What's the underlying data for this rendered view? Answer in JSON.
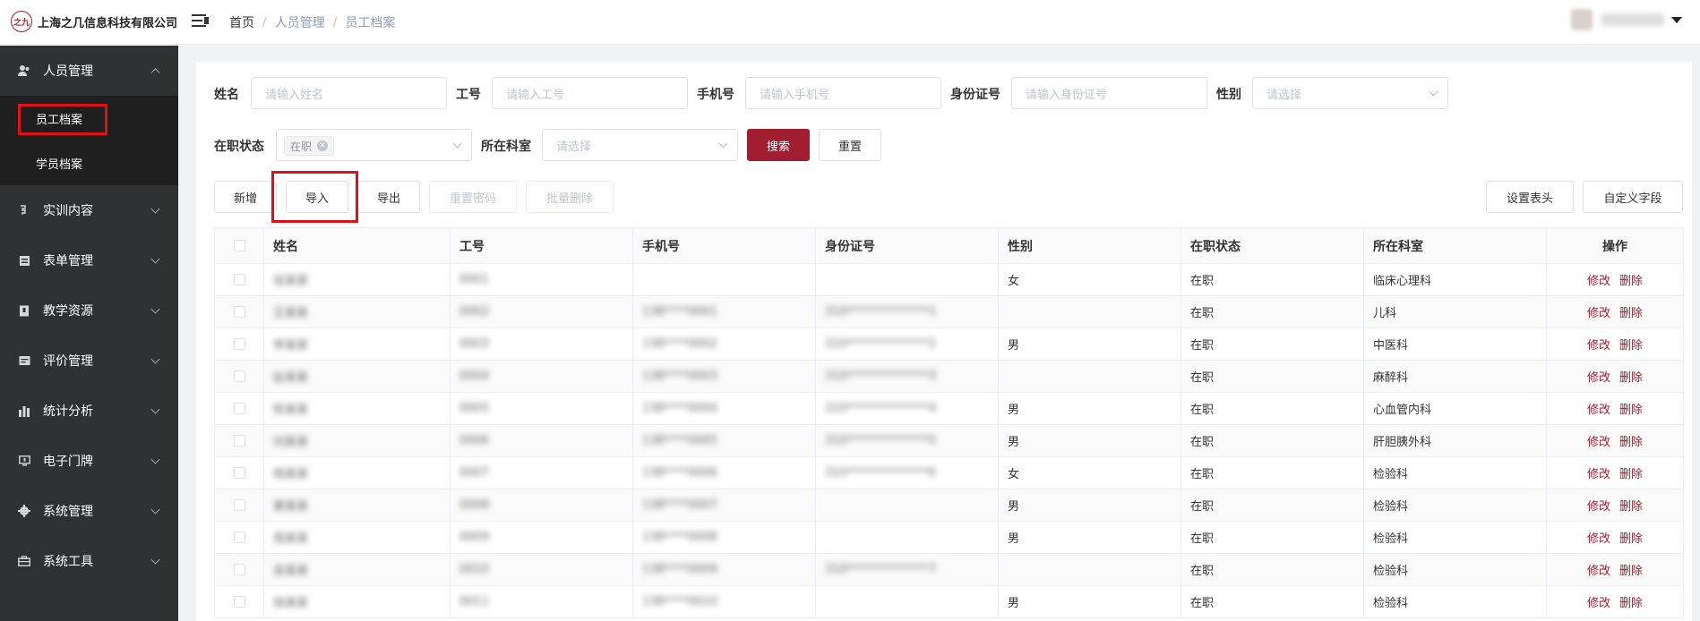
{
  "brand": {
    "logo_glyph": "之九",
    "company_name": "上海之几信息科技有限公司",
    "accent_color": "#a01e30"
  },
  "breadcrumb": [
    "首页",
    "人员管理",
    "员工档案"
  ],
  "user": {
    "name": "••••",
    "caret_icon": "caret-down-icon"
  },
  "sidebar": {
    "items": [
      {
        "label": "人员管理",
        "icon": "user-icon",
        "expanded": true,
        "children": [
          {
            "label": "员工档案",
            "active": true
          },
          {
            "label": "学员档案",
            "active": false
          }
        ]
      },
      {
        "label": "实训内容",
        "icon": "training-icon"
      },
      {
        "label": "表单管理",
        "icon": "form-icon"
      },
      {
        "label": "教学资源",
        "icon": "book-icon"
      },
      {
        "label": "评价管理",
        "icon": "evaluation-icon"
      },
      {
        "label": "统计分析",
        "icon": "bar-chart-icon"
      },
      {
        "label": "电子门牌",
        "icon": "monitor-icon"
      },
      {
        "label": "系统管理",
        "icon": "gear-icon"
      },
      {
        "label": "系统工具",
        "icon": "toolbox-icon"
      }
    ]
  },
  "filters": {
    "name_label": "姓名",
    "name_placeholder": "请输入姓名",
    "empno_label": "工号",
    "empno_placeholder": "请输入工号",
    "phone_label": "手机号",
    "phone_placeholder": "请输入手机号",
    "idcard_label": "身份证号",
    "idcard_placeholder": "请输入身份证号",
    "gender_label": "性别",
    "gender_placeholder": "请选择",
    "status_label": "在职状态",
    "status_tag": "在职",
    "dept_label": "所在科室",
    "dept_placeholder": "请选择",
    "search_button": "搜索",
    "reset_button": "重置"
  },
  "toolbar": {
    "add": "新增",
    "import": "导入",
    "export": "导出",
    "reset_password": "重置密码",
    "batch_delete": "批量删除",
    "set_header": "设置表头",
    "custom_fields": "自定义字段"
  },
  "table": {
    "columns": [
      "姓名",
      "工号",
      "手机号",
      "身份证号",
      "性别",
      "在职状态",
      "所在科室",
      "操作"
    ],
    "ops": {
      "edit": "修改",
      "delete": "删除"
    },
    "rows": [
      {
        "name": "张某某",
        "empno": "0001",
        "phone": "",
        "idcard": "",
        "gender": "女",
        "status": "在职",
        "dept": "临床心理科"
      },
      {
        "name": "王某某",
        "empno": "0002",
        "phone": "138****0001",
        "idcard": "310**************1",
        "gender": "",
        "status": "在职",
        "dept": "儿科"
      },
      {
        "name": "李某某",
        "empno": "0003",
        "phone": "138****0002",
        "idcard": "310**************2",
        "gender": "男",
        "status": "在职",
        "dept": "中医科"
      },
      {
        "name": "赵某某",
        "empno": "0004",
        "phone": "138****0003",
        "idcard": "310**************3",
        "gender": "",
        "status": "在职",
        "dept": "麻醉科"
      },
      {
        "name": "陈某某",
        "empno": "0005",
        "phone": "138****0004",
        "idcard": "310**************4",
        "gender": "男",
        "status": "在职",
        "dept": "心血管内科"
      },
      {
        "name": "刘某某",
        "empno": "0006",
        "phone": "138****0005",
        "idcard": "310**************5",
        "gender": "男",
        "status": "在职",
        "dept": "肝胆胰外科"
      },
      {
        "name": "杨某某",
        "empno": "0007",
        "phone": "138****0006",
        "idcard": "310**************6",
        "gender": "女",
        "status": "在职",
        "dept": "检验科"
      },
      {
        "name": "黄某某",
        "empno": "0008",
        "phone": "138****0007",
        "idcard": "",
        "gender": "男",
        "status": "在职",
        "dept": "检验科"
      },
      {
        "name": "周某某",
        "empno": "0009",
        "phone": "138****0008",
        "idcard": "",
        "gender": "男",
        "status": "在职",
        "dept": "检验科"
      },
      {
        "name": "吴某某",
        "empno": "0010",
        "phone": "138****0009",
        "idcard": "310**************7",
        "gender": "",
        "status": "在职",
        "dept": "检验科"
      },
      {
        "name": "徐某某",
        "empno": "0011",
        "phone": "138****0010",
        "idcard": "",
        "gender": "男",
        "status": "在职",
        "dept": "检验科"
      }
    ]
  }
}
